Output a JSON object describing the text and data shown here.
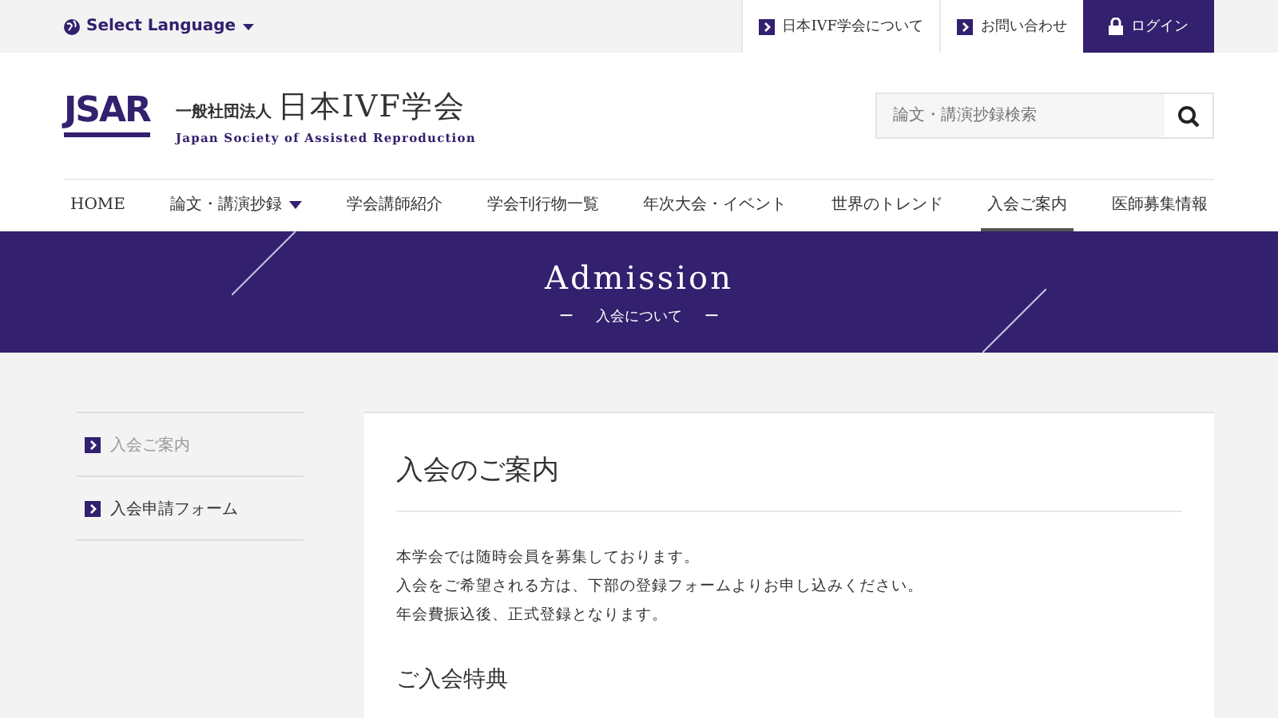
{
  "top_bar": {
    "language": "Select Language",
    "links": [
      {
        "label": "日本IVF学会について",
        "kind": "link"
      },
      {
        "label": "お問い合わせ",
        "kind": "link"
      },
      {
        "label": "ログイン",
        "kind": "login"
      }
    ]
  },
  "header": {
    "logo_mark": "JSAR",
    "org_prefix": "一般社団法人",
    "org_name": "日本IVF学会",
    "org_english": "Japan Society of Assisted Reproduction",
    "search": {
      "placeholder": "論文・講演抄録検索"
    }
  },
  "nav": [
    {
      "label": "HOME",
      "selected": false,
      "dropdown": false
    },
    {
      "label": "論文・講演抄録",
      "selected": false,
      "dropdown": true
    },
    {
      "label": "学会講師紹介",
      "selected": false,
      "dropdown": false
    },
    {
      "label": "学会刊行物一覧",
      "selected": false,
      "dropdown": false
    },
    {
      "label": "年次大会・イベント",
      "selected": false,
      "dropdown": false
    },
    {
      "label": "世界のトレンド",
      "selected": false,
      "dropdown": false
    },
    {
      "label": "入会ご案内",
      "selected": true,
      "dropdown": false
    },
    {
      "label": "医師募集情報",
      "selected": false,
      "dropdown": false
    }
  ],
  "banner": {
    "title": "Admission",
    "subtitle": "入会について",
    "dash_left": "ー",
    "dash_right": "ー"
  },
  "sidebar": {
    "items": [
      {
        "label": "入会ご案内",
        "selected": true
      },
      {
        "label": "入会申請フォーム",
        "selected": false
      }
    ]
  },
  "article": {
    "heading": "入会のご案内",
    "paragraphs": [
      "本学会では随時会員を募集しております。",
      "入会をご希望される方は、下部の登録フォームよりお申し込みください。",
      "年会費振込後、正式登録となります。"
    ],
    "subheading": "ご入会特典"
  }
}
